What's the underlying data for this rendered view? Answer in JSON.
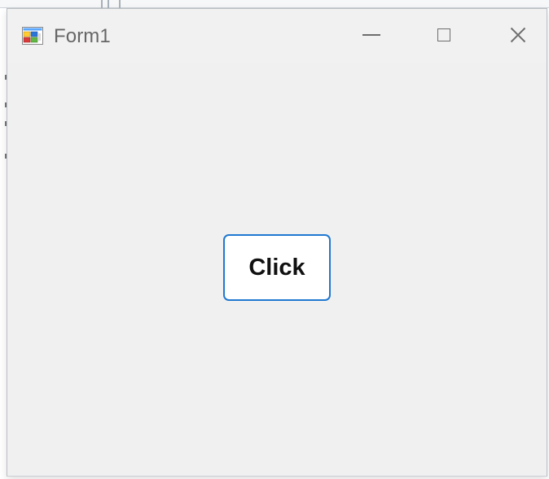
{
  "window": {
    "title": "Form1"
  },
  "controls": {
    "minimize_icon": "minimize-icon",
    "maximize_icon": "maximize-icon",
    "close_icon": "close-icon",
    "app_icon": "app-icon"
  },
  "content": {
    "button_label": "Click"
  },
  "colors": {
    "accent": "#1f78d1",
    "window_bg": "#f0f0f0",
    "title_text": "#666666"
  }
}
